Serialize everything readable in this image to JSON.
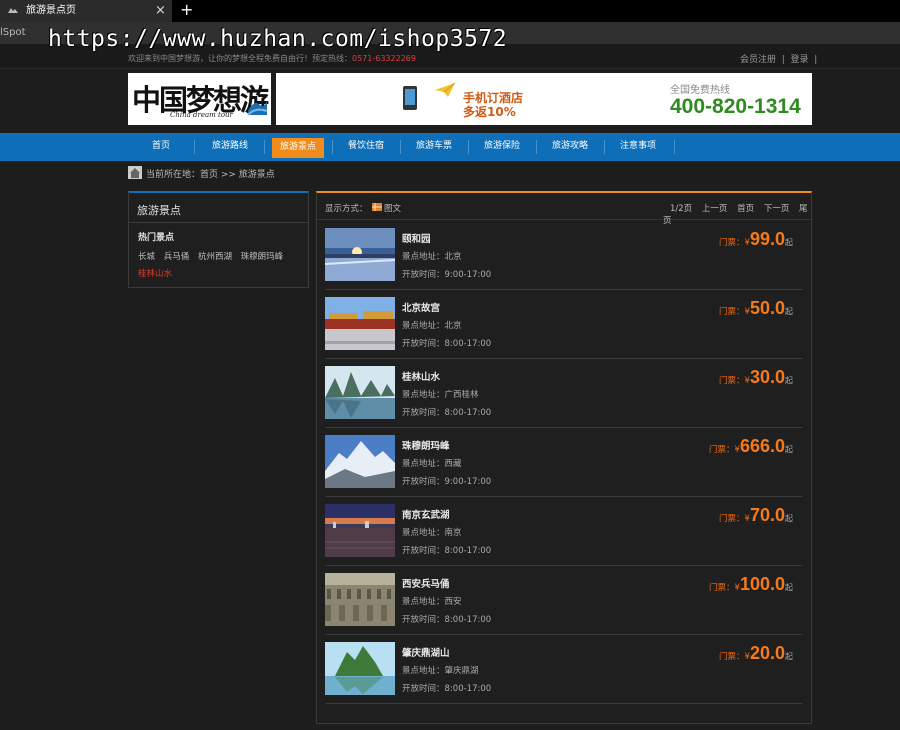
{
  "browser": {
    "tab_title": "旅游景点页",
    "tab_close": "×",
    "new_tab": "+",
    "bookmark": "lSpot"
  },
  "watermark": "https://www.huzhan.com/ishop3572",
  "topbar": {
    "welcome": "欢迎来到中国梦想游，让你的梦想全程免费自由行！预定热线：",
    "phone": "0571-63322269",
    "register": "会员注册",
    "sep": "|",
    "login": "登录"
  },
  "logo": {
    "text": "中国梦想游",
    "subtitle": "China dream tour"
  },
  "banner": {
    "line1": "手机订酒店",
    "line2": "多返10%",
    "hotline_label": "全国免费热线",
    "hotline_number": "400-820-1314"
  },
  "nav": {
    "items": [
      {
        "label": "首页"
      },
      {
        "label": "旅游路线"
      },
      {
        "label": "旅游景点",
        "active": true
      },
      {
        "label": "餐饮住宿"
      },
      {
        "label": "旅游车票"
      },
      {
        "label": "旅游保险"
      },
      {
        "label": "旅游攻略"
      },
      {
        "label": "注意事项"
      }
    ]
  },
  "breadcrumb": {
    "text": "当前所在地：首页 >> 旅游景点"
  },
  "sidebar": {
    "title": "旅游景点",
    "hot_title": "热门景点",
    "links": [
      "长城",
      "兵马俑",
      "杭州西湖",
      "珠穆朗玛峰",
      "桂林山水"
    ]
  },
  "toolbar": {
    "view_label": "显示方式：",
    "view_mode": "图文",
    "page_info": "1/2页",
    "prev": "上一页",
    "first": "首页",
    "next": "下一页",
    "last": "尾页"
  },
  "price_label": "门票：",
  "currency": "¥",
  "price_unit": "起",
  "addr_label": "景点地址：",
  "hours_label": "开放时间：",
  "spots": [
    {
      "name": "颐和园",
      "address": "北京",
      "hours": "9:00-17:00",
      "price": "99.0",
      "theme": "sunset"
    },
    {
      "name": "北京故宫",
      "address": "北京",
      "hours": "8:00-17:00",
      "price": "50.0",
      "theme": "palace"
    },
    {
      "name": "桂林山水",
      "address": "广西桂林",
      "hours": "8:00-17:00",
      "price": "30.0",
      "theme": "karst"
    },
    {
      "name": "珠穆朗玛峰",
      "address": "西藏",
      "hours": "9:00-17:00",
      "price": "666.0",
      "theme": "snow"
    },
    {
      "name": "南京玄武湖",
      "address": "南京",
      "hours": "8:00-17:00",
      "price": "70.0",
      "theme": "dusk"
    },
    {
      "name": "西安兵马俑",
      "address": "西安",
      "hours": "8:00-17:00",
      "price": "100.0",
      "theme": "terracotta"
    },
    {
      "name": "肇庆鼎湖山",
      "address": "肇庆鼎湖",
      "hours": "8:00-17:00",
      "price": "20.0",
      "theme": "lake"
    }
  ],
  "colors": {
    "nav_blue": "#0e6fb8",
    "accent_orange": "#f08c1c",
    "price_orange": "#f47a1a",
    "hot_red": "#e53a2a"
  }
}
